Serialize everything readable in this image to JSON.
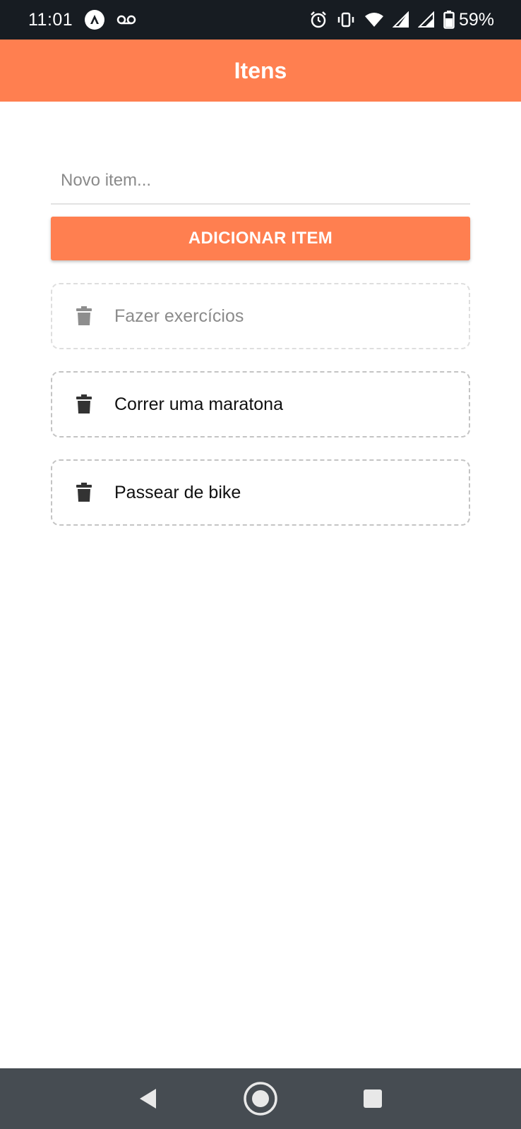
{
  "status_bar": {
    "time": "11:01",
    "battery": "59%",
    "left_icons": [
      "app-a-icon",
      "voicemail-icon"
    ],
    "right_icons": [
      "alarm-icon",
      "vibrate-icon",
      "wifi-icon",
      "signal-icon",
      "signal-icon",
      "battery-icon"
    ]
  },
  "header": {
    "title": "Itens",
    "color": "#ff7f50"
  },
  "input": {
    "placeholder": "Novo item...",
    "value": ""
  },
  "add_button": {
    "label": "ADICIONAR ITEM"
  },
  "items": [
    {
      "label": "Fazer exercícios",
      "icon": "trash-icon"
    },
    {
      "label": "Correr uma maratona",
      "icon": "trash-icon"
    },
    {
      "label": "Passear de bike",
      "icon": "trash-icon"
    }
  ],
  "nav_bar": {
    "buttons": [
      "back-icon",
      "home-icon",
      "recents-icon"
    ]
  }
}
